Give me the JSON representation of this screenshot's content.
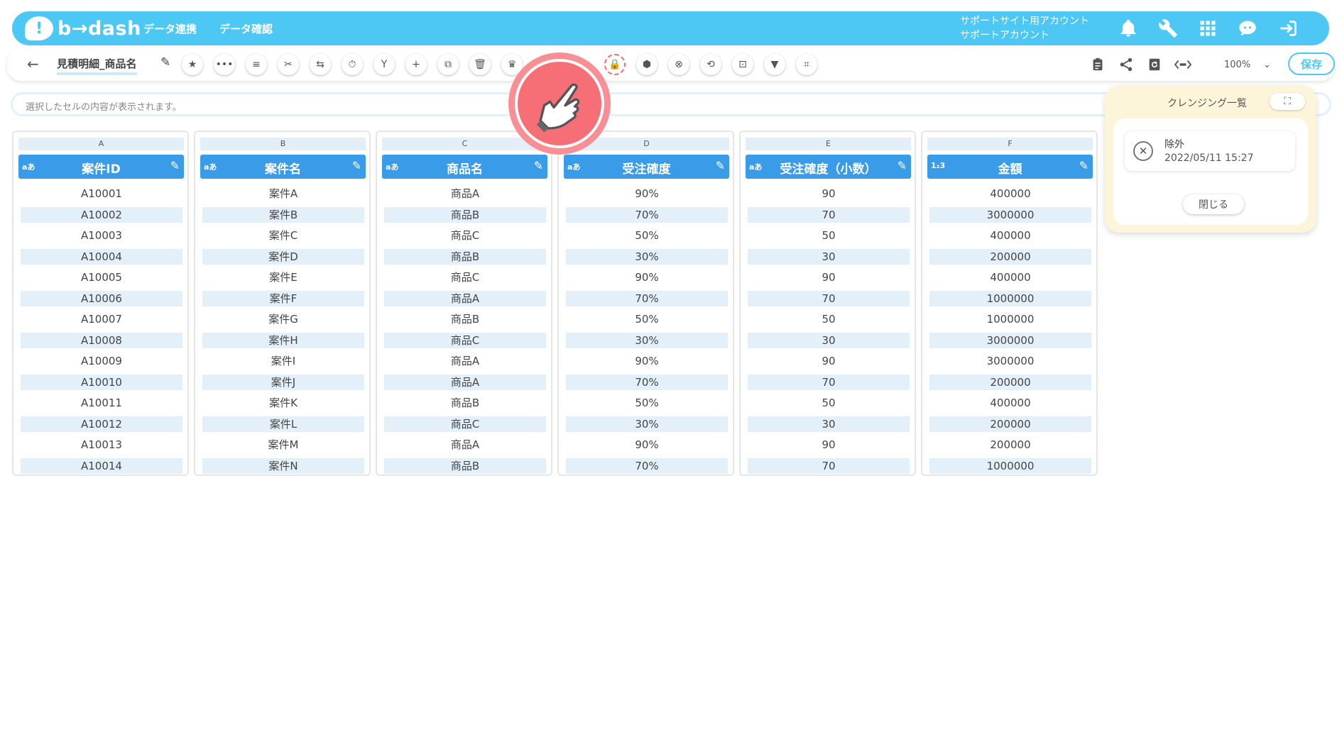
{
  "header": {
    "logo_mark": "!",
    "logo_text": "b→dash",
    "nav": [
      "データ連携",
      "データ確認"
    ],
    "account_line1": "サポートサイト用アカウント",
    "account_line2": "サポートアカウント",
    "icons": [
      "bell-icon",
      "wrench-icon",
      "apps-grid-icon",
      "chat-bot-icon",
      "logout-icon"
    ]
  },
  "toolbar": {
    "back": "←",
    "title": "見積明細_商品名",
    "zoom": "100%",
    "save": "保存",
    "tools": [
      "★",
      "•••",
      "≡",
      "✂",
      "⇆",
      "⏱",
      "Y",
      "+",
      "⧉",
      "🗑",
      "♛",
      "🔒",
      "⬢",
      "⊗",
      "⟲",
      "⊡",
      "▼",
      "⌗"
    ],
    "right_icons": [
      "clipboard-icon",
      "share-icon",
      "refresh-icon",
      "code-icon"
    ]
  },
  "cellbar": {
    "placeholder": "選択したセルの内容が表示されます。"
  },
  "grid": {
    "columns": [
      {
        "letter": "A",
        "type": "aあ",
        "name": "案件ID",
        "cells": [
          "A10001",
          "A10002",
          "A10003",
          "A10004",
          "A10005",
          "A10006",
          "A10007",
          "A10008",
          "A10009",
          "A10010",
          "A10011",
          "A10012",
          "A10013",
          "A10014"
        ]
      },
      {
        "letter": "B",
        "type": "aあ",
        "name": "案件名",
        "cells": [
          "案件A",
          "案件B",
          "案件C",
          "案件D",
          "案件E",
          "案件F",
          "案件G",
          "案件H",
          "案件I",
          "案件J",
          "案件K",
          "案件L",
          "案件M",
          "案件N"
        ]
      },
      {
        "letter": "C",
        "type": "aあ",
        "name": "商品名",
        "cells": [
          "商品A",
          "商品B",
          "商品C",
          "商品B",
          "商品C",
          "商品A",
          "商品B",
          "商品C",
          "商品A",
          "商品A",
          "商品B",
          "商品C",
          "商品A",
          "商品B"
        ]
      },
      {
        "letter": "D",
        "type": "aあ",
        "name": "受注確度",
        "cells": [
          "90%",
          "70%",
          "50%",
          "30%",
          "90%",
          "70%",
          "50%",
          "30%",
          "90%",
          "70%",
          "50%",
          "30%",
          "90%",
          "70%"
        ]
      },
      {
        "letter": "E",
        "type": "aあ",
        "name": "受注確度（小数）",
        "cells": [
          "90",
          "70",
          "50",
          "30",
          "90",
          "70",
          "50",
          "30",
          "90",
          "70",
          "50",
          "30",
          "90",
          "70"
        ]
      },
      {
        "letter": "F",
        "type": "1₂3",
        "name": "金額",
        "cells": [
          "400000",
          "3000000",
          "400000",
          "200000",
          "400000",
          "1000000",
          "1000000",
          "3000000",
          "3000000",
          "200000",
          "400000",
          "200000",
          "200000",
          "1000000"
        ]
      }
    ]
  },
  "panel": {
    "title": "クレンジング一覧",
    "item_label": "除外",
    "item_date": "2022/05/11 15:27",
    "close": "閉じる"
  },
  "colors": {
    "brand": "#4dc8f5",
    "column_header": "#3a9be8",
    "row_shade": "#e3f0fa",
    "highlight": "#f06a72"
  }
}
